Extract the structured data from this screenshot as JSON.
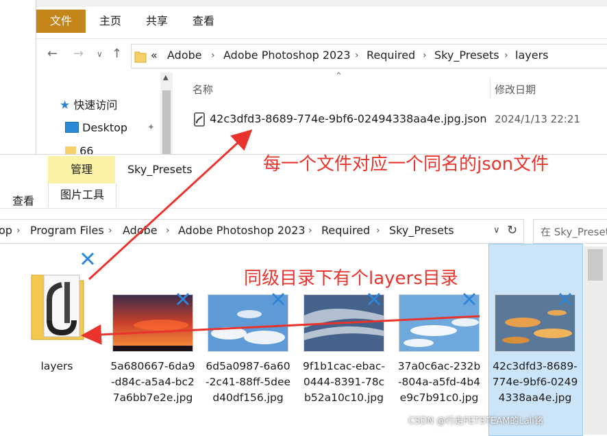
{
  "back_window": {
    "ribbon_tabs": [
      "文件",
      "主页",
      "共享",
      "查看"
    ],
    "breadcrumb_lead": "«",
    "breadcrumb": [
      "Adobe",
      "Adobe Photoshop 2023",
      "Required",
      "Sky_Presets",
      "layers"
    ],
    "sidebar": [
      {
        "label": "快速访问",
        "icon": "star-icon"
      },
      {
        "label": "Desktop",
        "icon": "desktop-icon"
      },
      {
        "label": "66",
        "icon": "folder-icon"
      }
    ],
    "columns": {
      "name": "名称",
      "modified": "修改日期"
    },
    "files": [
      {
        "name": "42c3dfd3-8689-774e-9bf6-02494338aa4e.jpg.json",
        "modified": "2024/1/13 22:21",
        "icon": "shortcut-file-icon"
      }
    ]
  },
  "front_window": {
    "context_tab": "管理",
    "title": "Sky_Presets",
    "ribbon_tabs": [
      "查看",
      "图片工具"
    ],
    "breadcrumb_lead": "op",
    "breadcrumb": [
      "Program Files",
      "Adobe",
      "Adobe Photoshop 2023",
      "Required",
      "Sky_Presets"
    ],
    "search_placeholder": "在 Sky_Preset",
    "items": [
      {
        "name": "layers",
        "type": "folder"
      },
      {
        "name": "5a680667-6da9-d84c-a5a4-bc27a6bb7e2e.jpg",
        "type": "image",
        "sky": "sunset"
      },
      {
        "name": "6d5a0987-6a60-2c41-88ff-5deed40df156.jpg",
        "type": "image",
        "sky": "blue-clouds"
      },
      {
        "name": "9f1b1cac-ebac-0444-8391-78cb52a10c10.jpg",
        "type": "image",
        "sky": "grey-clouds"
      },
      {
        "name": "37a0c6ac-232b-804a-a5fd-4b4e9c7b91c0.jpg",
        "type": "image",
        "sky": "light-clouds"
      },
      {
        "name": "42c3dfd3-8689-774e-9bf6-02494338aa4e.jpg",
        "type": "image",
        "sky": "golden-clouds",
        "selected": true
      }
    ]
  },
  "annotations": {
    "top": "每一个文件对应一个同名的json文件",
    "middle": "同级目录下有个layers目录"
  },
  "watermark": "CSDN @行走FETSTEAM的Lali铭",
  "colors": {
    "annotation": "#e8342c",
    "file_tab": "#c4861a",
    "context_tab": "#fcf2a6",
    "selection": "#cce4f7"
  }
}
